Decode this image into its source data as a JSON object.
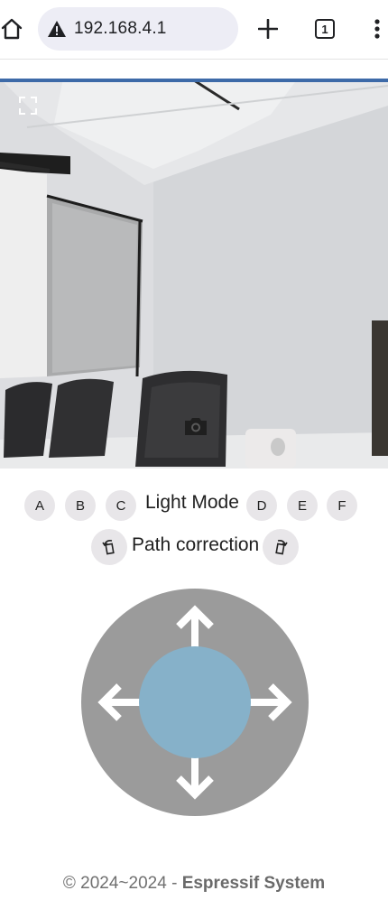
{
  "browser": {
    "url": "192.168.4.1",
    "tab_count": "1",
    "icons": {
      "home": "home-icon",
      "warning": "not-secure-warning-icon",
      "new_tab": "plus-icon",
      "tabs": "tab-switcher-icon",
      "menu": "more-vert-icon"
    }
  },
  "camera": {
    "icons": {
      "fullscreen": "fullscreen-icon",
      "snapshot": "camera-icon"
    }
  },
  "light_mode": {
    "label": "Light Mode",
    "buttons_left": [
      "A",
      "B",
      "C"
    ],
    "buttons_right": [
      "D",
      "E",
      "F"
    ]
  },
  "path_correction": {
    "label": "Path correction",
    "icons": {
      "left": "rotate-left-icon",
      "right": "rotate-right-icon"
    }
  },
  "joystick": {
    "icons": [
      "arrow-up-icon",
      "arrow-down-icon",
      "arrow-left-icon",
      "arrow-right-icon"
    ],
    "colors": {
      "ring": "#9b9b9b",
      "knob": "#86b1c9",
      "arrows": "#ffffff"
    }
  },
  "footer": {
    "copyright": "© 2024~2024 - ",
    "company": "Espressif System"
  }
}
